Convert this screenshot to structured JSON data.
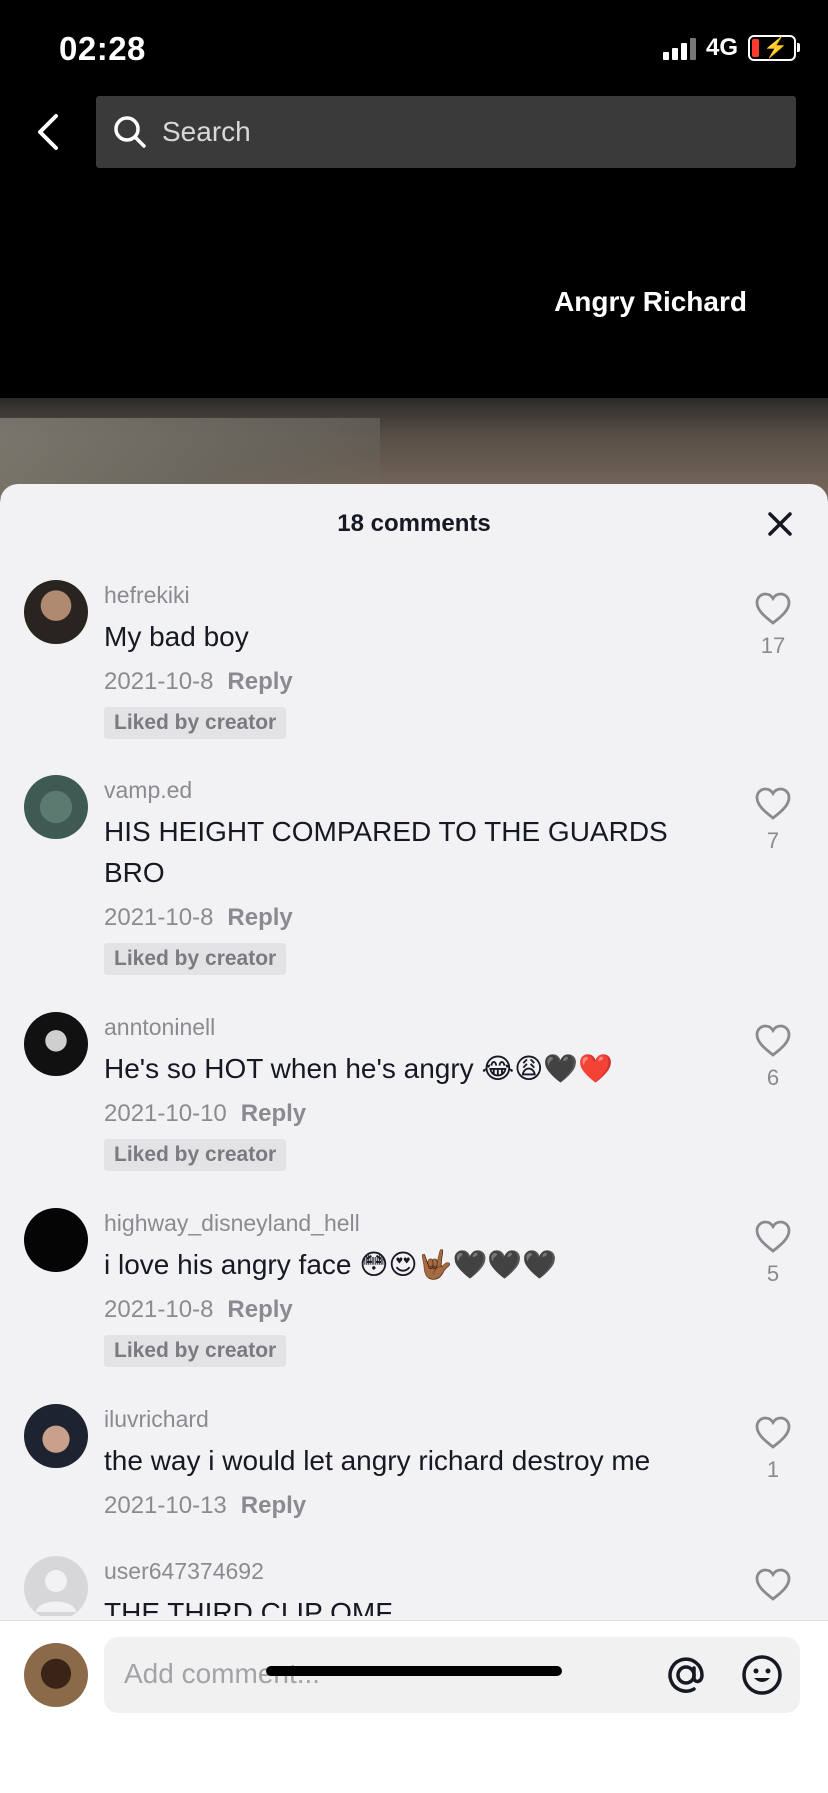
{
  "status": {
    "time": "02:28",
    "network": "4G"
  },
  "search": {
    "placeholder": "Search"
  },
  "video": {
    "caption": "Angry Richard"
  },
  "comments_header": {
    "count_label": "18 comments"
  },
  "comments": [
    {
      "user": "hefrekiki",
      "text": "My bad boy",
      "date": "2021-10-8",
      "reply": "Reply",
      "badge": "Liked by creator",
      "likes": "17"
    },
    {
      "user": "vamp.ed",
      "text": "HIS HEIGHT COMPARED TO THE GUARDS BRO",
      "date": "2021-10-8",
      "reply": "Reply",
      "badge": "Liked by creator",
      "likes": "7"
    },
    {
      "user": "anntoninell",
      "text": "He's so HOT when he's angry 😂😩🖤❤️",
      "date": "2021-10-10",
      "reply": "Reply",
      "badge": "Liked by creator",
      "likes": "6"
    },
    {
      "user": "highway_disneyland_hell",
      "text": "i love his angry face 😳😍🤟🏾🖤🖤🖤",
      "date": "2021-10-8",
      "reply": "Reply",
      "badge": "Liked by creator",
      "likes": "5"
    },
    {
      "user": "iluvrichard",
      "text": "the way i would let angry richard destroy me",
      "date": "2021-10-13",
      "reply": "Reply",
      "likes": "1"
    },
    {
      "user": "user647374692",
      "text": "THE THIRD CLIP OMF"
    }
  ],
  "composer": {
    "placeholder": "Add comment..."
  },
  "colors": {
    "sheet_bg": "#f2f2f4",
    "muted_text": "#8a8b91",
    "primary_text": "#161823"
  }
}
